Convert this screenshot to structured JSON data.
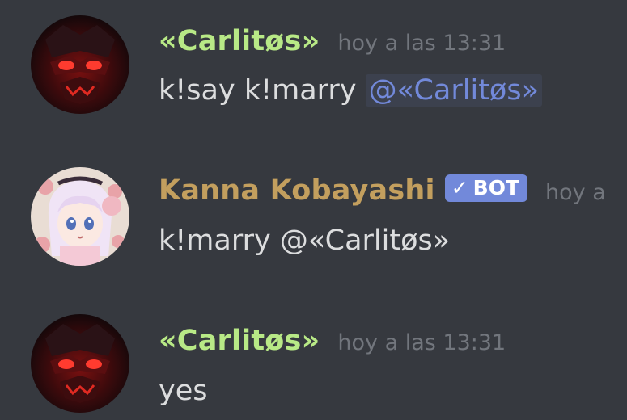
{
  "messages": [
    {
      "author": "«Carlitøs»",
      "author_color": "#b8e986",
      "timestamp": "hoy a las 13:31",
      "avatar": "demon-mask-avatar",
      "content_prefix": "k!say k!marry ",
      "mention": "@«Carlitøs»"
    },
    {
      "author": "Kanna Kobayashi",
      "author_color": "#c39f5e",
      "bot_check": "✓",
      "bot_label": "BOT",
      "timestamp": "hoy a",
      "avatar": "anime-girl-avatar",
      "content": "k!marry @«Carlitøs»"
    },
    {
      "author": "«Carlitøs»",
      "author_color": "#b8e986",
      "timestamp": "hoy a las 13:31",
      "avatar": "demon-mask-avatar",
      "content": "yes"
    }
  ],
  "colors": {
    "background": "#36393f",
    "text": "#dcddde",
    "timestamp": "#72767d",
    "mention": "#7289da",
    "bot_tag": "#7289da"
  }
}
